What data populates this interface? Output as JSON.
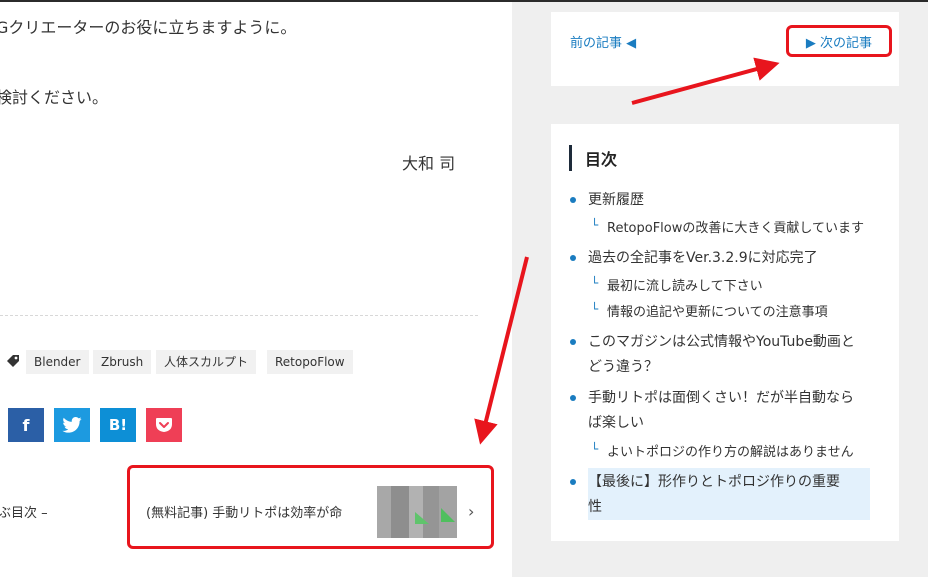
{
  "article": {
    "line1": "Gクリエーターのお役に立ちますように。",
    "line2": "検討ください。",
    "author": "大和 司"
  },
  "tags": [
    "Blender",
    "Zbrush",
    "人体スカルプト",
    "RetopoFlow"
  ],
  "share": {
    "facebook": "f",
    "hatena": "B!"
  },
  "post_nav": {
    "prev_toc": "ぶ目次 –",
    "next_title": "(無料記事) 手動リトポは効率が命",
    "next_chevron": "›"
  },
  "sidebar": {
    "prev_label": "前の記事 ◀",
    "next_label": "▶ 次の記事",
    "toc_title": "目次",
    "toc": [
      {
        "text": "更新履歴",
        "level": 1
      },
      {
        "text": "RetopoFlowの改善に大きく貢献しています",
        "level": 2
      },
      {
        "text": "過去の全記事をVer.3.2.9に対応完了",
        "level": 1
      },
      {
        "text": "最初に流し読みして下さい",
        "level": 2
      },
      {
        "text": "情報の追記や更新についての注意事項",
        "level": 2
      },
      {
        "text": "このマガジンは公式情報やYouTube動画と",
        "level": 1
      },
      {
        "text": "どう違う？",
        "level": 1
      },
      {
        "text": "手動リトポは面倒くさい！だが半自動なら",
        "level": 1
      },
      {
        "text": "ば楽しい",
        "level": 1
      },
      {
        "text": "よいトポロジの作り方の解説はありません",
        "level": 2
      },
      {
        "text": "【最後に】形作りとトポロジ作りの重要",
        "level": 1
      },
      {
        "text": "性",
        "level": 1
      }
    ],
    "toc_sub_mark": "└"
  },
  "colors": {
    "accent_blue": "#1a7cc0",
    "annotation_red": "#e8151d",
    "sidebar_bg": "#efefef",
    "highlight": "#e3f1fc"
  }
}
